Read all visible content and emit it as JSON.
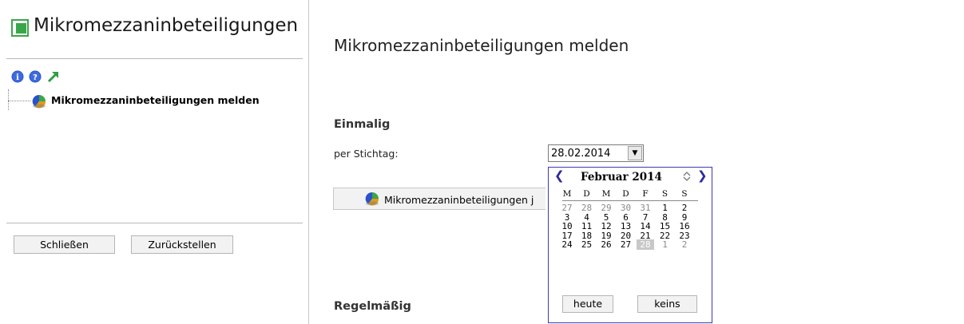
{
  "sidebar": {
    "title": "Mikromezzaninbeteiligungen",
    "tree_item_label": "Mikromezzaninbeteiligungen melden",
    "icons": [
      "info-icon",
      "help-icon",
      "external-link-icon"
    ],
    "buttons": {
      "close_label": "Schließen",
      "reset_label": "Zurückstellen"
    }
  },
  "main": {
    "title": "Mikromezzaninbeteiligungen melden",
    "section_once": "Einmalig",
    "section_regular": "Regelmäßig",
    "date_label": "per Stichtag:",
    "date_value": "28.02.2014",
    "report_button_label": "Mikromezzaninbeteiligungen j"
  },
  "calendar": {
    "title": "Februar 2014",
    "weekdays": [
      "M",
      "D",
      "M",
      "D",
      "F",
      "S",
      "S"
    ],
    "weeks": [
      [
        "27",
        "28",
        "29",
        "30",
        "31",
        "1",
        "2"
      ],
      [
        "3",
        "4",
        "5",
        "6",
        "7",
        "8",
        "9"
      ],
      [
        "10",
        "11",
        "12",
        "13",
        "14",
        "15",
        "16"
      ],
      [
        "17",
        "18",
        "19",
        "20",
        "21",
        "22",
        "23"
      ],
      [
        "24",
        "25",
        "26",
        "27",
        "28",
        "1",
        "2"
      ]
    ],
    "selected_day": "28",
    "today_label": "heute",
    "none_label": "keins"
  },
  "colors": {
    "accent_green": "#3aa64a",
    "calendar_border": "#3a3ab0",
    "selected_day_bg": "#c8c8c8"
  }
}
